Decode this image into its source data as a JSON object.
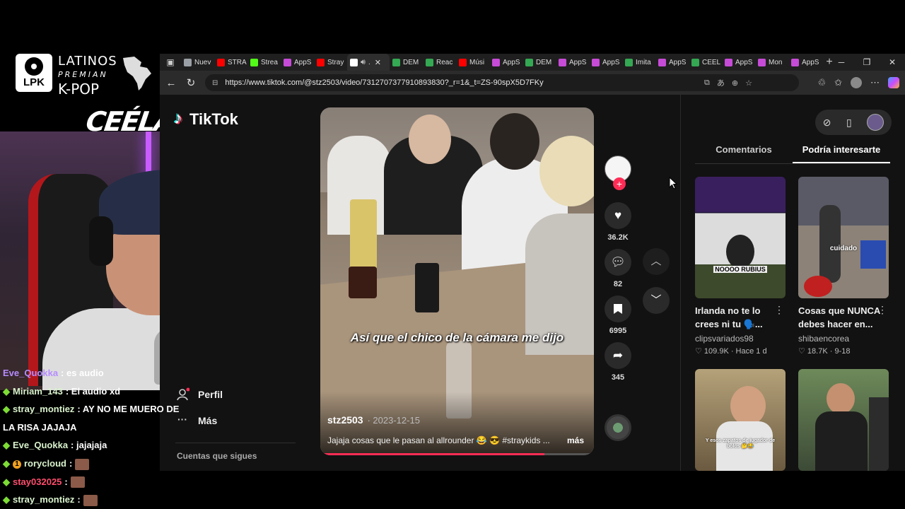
{
  "overlay": {
    "brand_line1": "LATINOS",
    "brand_line2": "PREMIAN",
    "brand_line3": "K-POP",
    "badge_text": "LPK",
    "ceela_text": "CEÉLA"
  },
  "tabs": [
    {
      "label": "Nuev",
      "icon": "page-icon",
      "color": "#9aa0a6"
    },
    {
      "label": "STRA",
      "icon": "youtube-icon",
      "color": "#ff0000"
    },
    {
      "label": "Strea",
      "icon": "kick-icon",
      "color": "#53fc18"
    },
    {
      "label": "AppS",
      "icon": "appsheet-icon",
      "color": "#c64bd6"
    },
    {
      "label": "Stray",
      "icon": "youtube-icon",
      "color": "#ff0000"
    },
    {
      "label": ".",
      "icon": "tiktok-icon",
      "color": "#ffffff",
      "active": true
    },
    {
      "label": "DEM",
      "icon": "drive-icon",
      "color": "#34a853"
    },
    {
      "label": "Reac",
      "icon": "drive-icon",
      "color": "#34a853"
    },
    {
      "label": "Músi",
      "icon": "youtube-icon",
      "color": "#ff0000"
    },
    {
      "label": "AppS",
      "icon": "appsheet-icon",
      "color": "#c64bd6"
    },
    {
      "label": "DEM",
      "icon": "drive-icon",
      "color": "#34a853"
    },
    {
      "label": "AppS",
      "icon": "appsheet-icon",
      "color": "#c64bd6"
    },
    {
      "label": "AppS",
      "icon": "appsheet-icon",
      "color": "#c64bd6"
    },
    {
      "label": "Imita",
      "icon": "drive-icon",
      "color": "#34a853"
    },
    {
      "label": "AppS",
      "icon": "appsheet-icon",
      "color": "#c64bd6"
    },
    {
      "label": "CEEL",
      "icon": "drive-icon",
      "color": "#34a853"
    },
    {
      "label": "AppS",
      "icon": "appsheet-icon",
      "color": "#c64bd6"
    },
    {
      "label": "Mon",
      "icon": "appsheet-icon",
      "color": "#c64bd6"
    },
    {
      "label": "AppS",
      "icon": "appsheet-icon",
      "color": "#c64bd6"
    }
  ],
  "address_bar": {
    "url": "https://www.tiktok.com/@stz2503/video/7312707377910893830?_r=1&_t=ZS-90spX5D7FKy"
  },
  "tiktok": {
    "logo_text": "TikTok",
    "sidebar": {
      "profile_label": "Perfil",
      "more_label": "Más",
      "following_header": "Cuentas que sigues"
    },
    "video": {
      "caption": "Así que el chico de la cámara me dijo",
      "author": "stz2503",
      "date": "· 2023-12-15",
      "description": "Jajaja cosas que le pasan al allrounder 😂 😎 #straykids ...",
      "more_label": "más",
      "progress": 0.82
    },
    "actions": {
      "likes": "36.2K",
      "comments": "82",
      "saves": "6995",
      "shares": "345"
    },
    "right_tabs": {
      "comments": "Comentarios",
      "recommended": "Podría interesarte"
    },
    "recommended": [
      {
        "title": "Irlanda no te lo crees ni tu 🗣️...",
        "author": "clipsvariados98",
        "stats": "♡ 109.9K · Hace 1 d",
        "thumb_text": "NOOOO RUBIUS"
      },
      {
        "title": "Cosas que NUNCA debes hacer en...",
        "author": "shibaencorea",
        "stats": "♡ 18.7K · 9-18",
        "thumb_text": "cuidado"
      },
      {
        "title": "",
        "author": "",
        "stats": "",
        "thumb_text": "Y esos zapatos de jugador de bolos 🤔😂"
      },
      {
        "title": "",
        "author": "",
        "stats": "",
        "thumb_text": ""
      }
    ]
  },
  "chat": [
    {
      "user": "Eve_Quokka",
      "text": ": es audio"
    },
    {
      "user": "Miriam_143",
      "text": ": El audio xd"
    },
    {
      "user": "stray_montiez",
      "text": ": AY NO ME MUERO DE",
      "cont": "LA RISA JAJAJA"
    },
    {
      "user": "Eve_Quokka",
      "text": ": jajajaja"
    },
    {
      "user": "rorycloud",
      "text": ":"
    },
    {
      "user": "stay032025",
      "text": ":"
    },
    {
      "user": "stray_montiez",
      "text": ":"
    }
  ]
}
